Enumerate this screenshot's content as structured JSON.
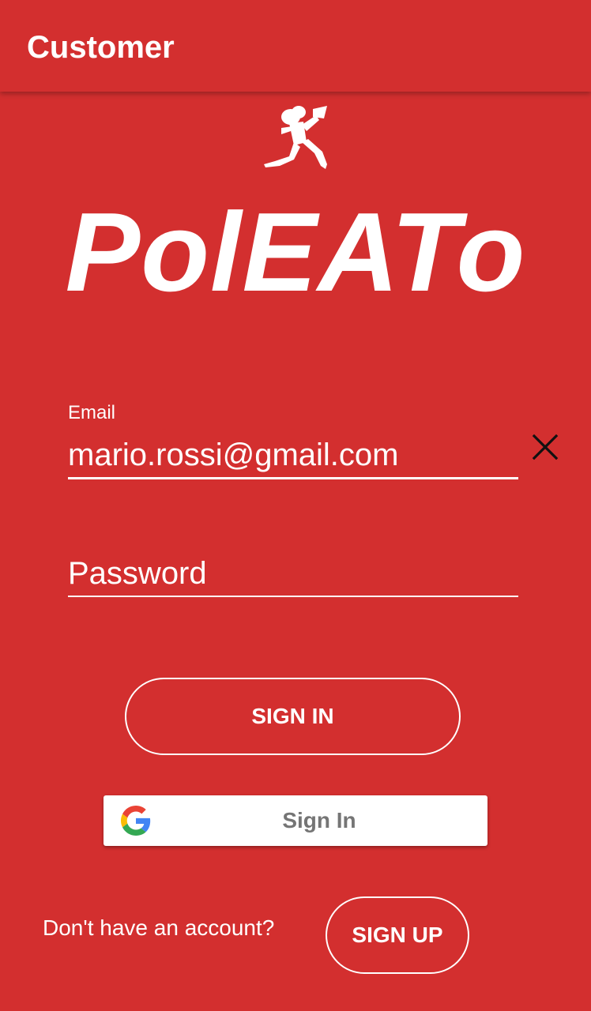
{
  "appbar": {
    "title": "Customer"
  },
  "brand": {
    "name": "PolEATo",
    "logo_icon": "running-chef-icon"
  },
  "form": {
    "email_label": "Email",
    "email_value": "mario.rossi@gmail.com",
    "password_placeholder": "Password",
    "clear_icon": "close-icon"
  },
  "actions": {
    "sign_in": "SIGN IN",
    "google_sign_in": "Sign In",
    "google_icon": "google-icon",
    "no_account_text": "Don't have an account?",
    "sign_up": "SIGN UP"
  },
  "colors": {
    "primary": "#D32F2F",
    "text_on_primary": "#FFFFFF",
    "google_label": "#757575"
  }
}
